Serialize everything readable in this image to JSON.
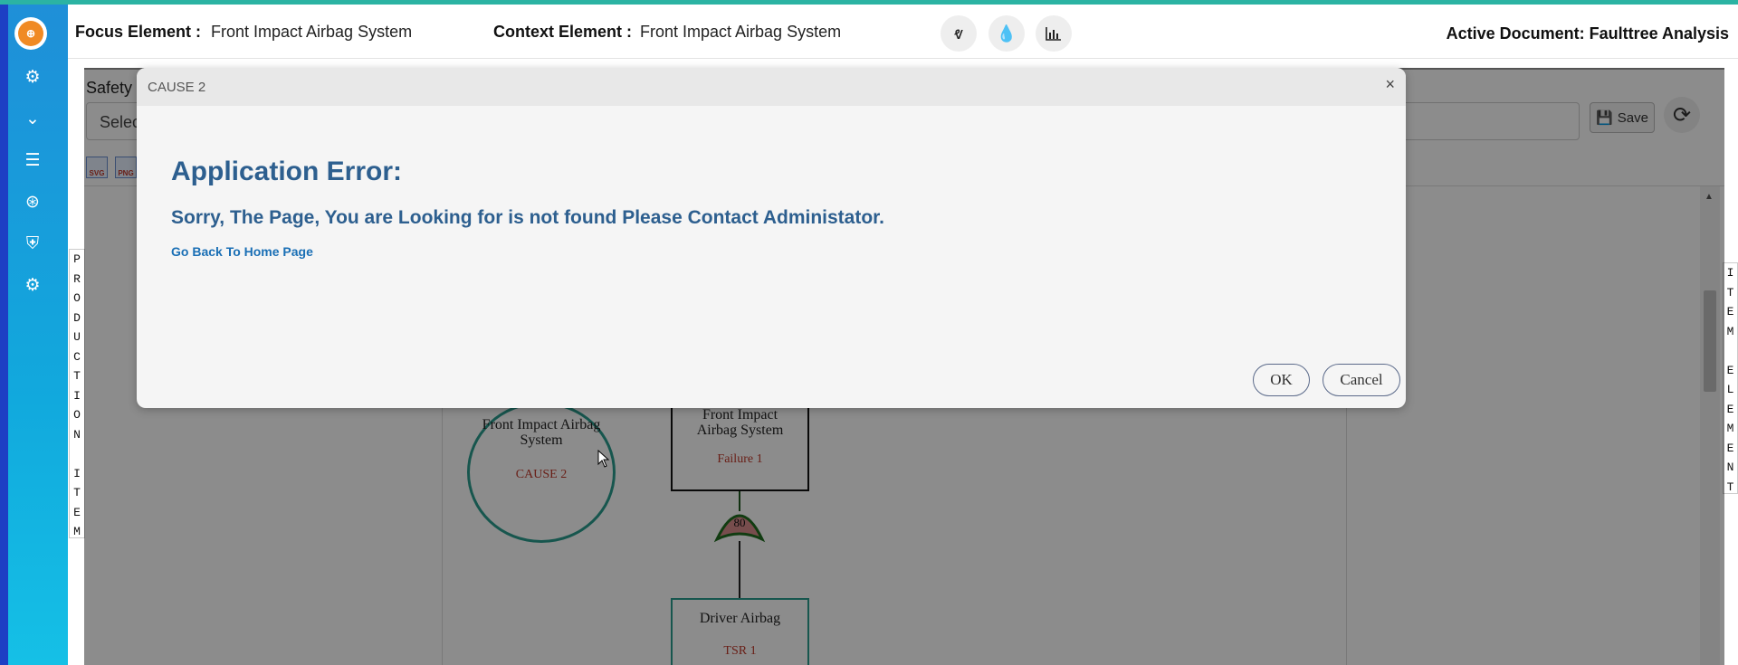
{
  "header": {
    "focus_label": "Focus Element :",
    "focus_value": "Front Impact Airbag System",
    "context_label": "Context Element :",
    "context_value": "Front Impact Airbag System",
    "active_doc": "Active Document: Faulttree Analysis",
    "buttons": [
      "vine-icon",
      "drop-icon",
      "bar-chart-icon"
    ]
  },
  "sidebar": {
    "items": [
      "cogs-icon",
      "chevrons-down-icon",
      "list-icon",
      "life-ring-icon",
      "shield-icon",
      "cogs-icon"
    ]
  },
  "workspace": {
    "tab_label": "Safety",
    "select_text": "Selec",
    "save_label": "Save",
    "export_icons": [
      "SVG",
      "PNG"
    ]
  },
  "side_tabs": {
    "left": [
      "P",
      "R",
      "O",
      "D",
      "U",
      "C",
      "T",
      "I",
      "O",
      "N",
      "",
      "I",
      "T",
      "E",
      "M"
    ],
    "right": [
      "I",
      "T",
      "E",
      "M",
      "",
      "E",
      "L",
      "E",
      "M",
      "E",
      "N",
      "T"
    ]
  },
  "tree": {
    "circle_title": "Front Impact Airbag System",
    "circle_sub": "CAUSE 2",
    "box1_title": "Front Impact Airbag System",
    "box1_sub": "Failure 1",
    "gate_label": "80",
    "box2_title": "Driver Airbag",
    "box2_sub": "TSR 1"
  },
  "modal": {
    "title": "CAUSE 2",
    "close": "×",
    "error_title": "Application Error:",
    "error_message": "Sorry, The Page, You are Looking for is not found Please Contact Administator.",
    "home_link": "Go Back To Home Page",
    "ok_label": "OK",
    "cancel_label": "Cancel"
  }
}
